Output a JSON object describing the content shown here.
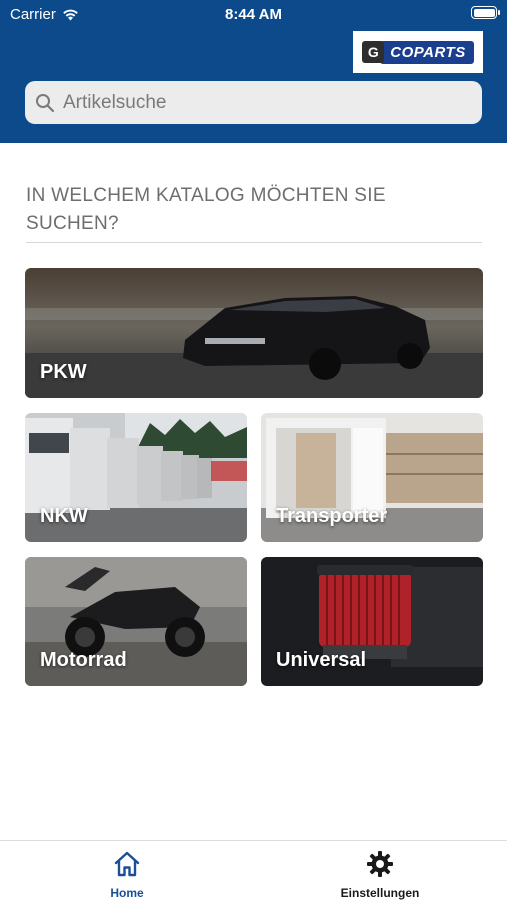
{
  "status_bar": {
    "carrier": "Carrier",
    "time": "8:44 AM"
  },
  "header": {
    "logo_text": "COPARTS",
    "logo_mark": "G"
  },
  "search": {
    "placeholder": "Artikelsuche"
  },
  "catalog": {
    "question": "IN WELCHEM KATALOG MÖCHTEN SIE SUCHEN?",
    "tiles": [
      {
        "label": "PKW"
      },
      {
        "label": "NKW"
      },
      {
        "label": "Transporter"
      },
      {
        "label": "Motorrad"
      },
      {
        "label": "Universal"
      }
    ]
  },
  "tabbar": {
    "items": [
      {
        "label": "Home",
        "icon": "home-icon",
        "active": true
      },
      {
        "label": "Einstellungen",
        "icon": "gear-icon",
        "active": false
      }
    ]
  },
  "colors": {
    "header": "#0c4a8c",
    "active_tab": "#1b4f95",
    "inactive_tab": "#1a1a1a"
  }
}
